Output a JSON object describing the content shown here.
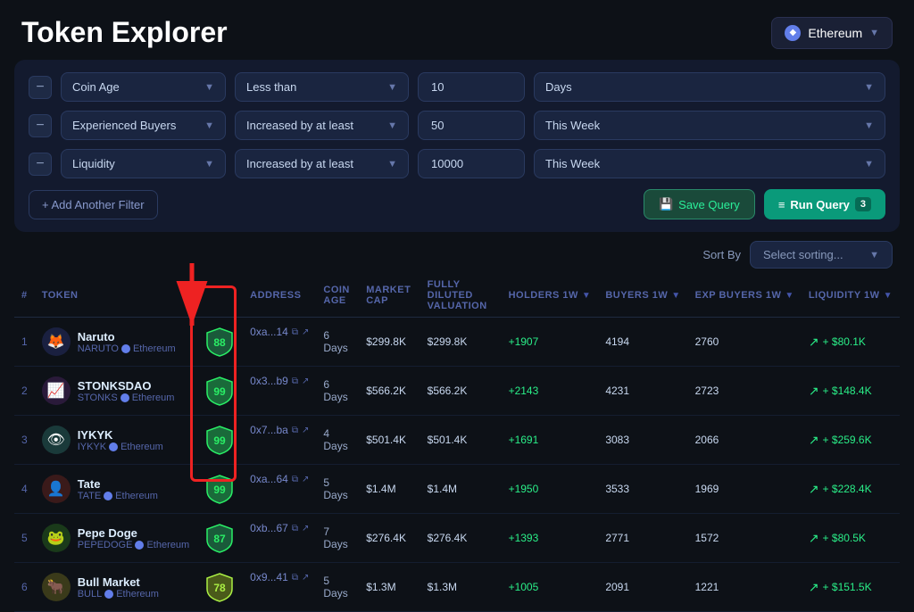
{
  "page": {
    "title": "Token Explorer"
  },
  "network": {
    "label": "Ethereum",
    "icon": "ethereum-icon"
  },
  "filters": [
    {
      "id": 1,
      "category": "Coin Age",
      "condition": "Less than",
      "value": "10",
      "period": "Days"
    },
    {
      "id": 2,
      "category": "Experienced Buyers",
      "condition": "Increased by at least",
      "value": "50",
      "period": "This Week"
    },
    {
      "id": 3,
      "category": "Liquidity",
      "condition": "Increased by at least",
      "value": "10000",
      "period": "This Week"
    }
  ],
  "actions": {
    "add_filter": "+ Add Another Filter",
    "save_query": "Save Query",
    "run_query": "Run Query",
    "run_badge": "3"
  },
  "sort": {
    "label": "Sort By",
    "placeholder": "Select sorting..."
  },
  "table": {
    "headers": [
      "#",
      "TOKEN",
      "",
      "ADDRESS",
      "COIN AGE",
      "MARKET CAP",
      "FULLY DILUTED VALUATION",
      "HOLDERS 1W",
      "BUYERS 1W",
      "EXP BUYERS 1W",
      "LIQUIDITY 1W"
    ],
    "rows": [
      {
        "rank": 1,
        "name": "Naruto",
        "ticker": "NARUTO",
        "chain": "Ethereum",
        "score": 88,
        "score_type": "high",
        "address": "0xa...14",
        "coin_age": "6 Days",
        "market_cap": "$299.8K",
        "fdv": "$299.8K",
        "holders": "+1907",
        "buyers": "4194",
        "exp_buyers": "2760",
        "liquidity": "+ $80.1K",
        "avatar": "🦊"
      },
      {
        "rank": 2,
        "name": "STONKSDAO",
        "ticker": "STONKS",
        "chain": "Ethereum",
        "score": 99,
        "score_type": "high",
        "address": "0x3...b9",
        "coin_age": "6 Days",
        "market_cap": "$566.2K",
        "fdv": "$566.2K",
        "holders": "+2143",
        "buyers": "4231",
        "exp_buyers": "2723",
        "liquidity": "+ $148.4K",
        "avatar": "📈"
      },
      {
        "rank": 3,
        "name": "IYKYK",
        "ticker": "IYKYK",
        "chain": "Ethereum",
        "score": 99,
        "score_type": "high",
        "address": "0x7...ba",
        "coin_age": "4 Days",
        "market_cap": "$501.4K",
        "fdv": "$501.4K",
        "holders": "+1691",
        "buyers": "3083",
        "exp_buyers": "2066",
        "liquidity": "+ $259.6K",
        "avatar": "👁"
      },
      {
        "rank": 4,
        "name": "Tate",
        "ticker": "TATE",
        "chain": "Ethereum",
        "score": 99,
        "score_type": "high",
        "address": "0xa...64",
        "coin_age": "5 Days",
        "market_cap": "$1.4M",
        "fdv": "$1.4M",
        "holders": "+1950",
        "buyers": "3533",
        "exp_buyers": "1969",
        "liquidity": "+ $228.4K",
        "avatar": "👤"
      },
      {
        "rank": 5,
        "name": "Pepe Doge",
        "ticker": "PEPEDOGE",
        "chain": "Ethereum",
        "score": 87,
        "score_type": "high",
        "address": "0xb...67",
        "coin_age": "7 Days",
        "market_cap": "$276.4K",
        "fdv": "$276.4K",
        "holders": "+1393",
        "buyers": "2771",
        "exp_buyers": "1572",
        "liquidity": "+ $80.5K",
        "avatar": "🐸"
      },
      {
        "rank": 6,
        "name": "Bull Market",
        "ticker": "BULL",
        "chain": "Ethereum",
        "score": 78,
        "score_type": "med",
        "address": "0x9...41",
        "coin_age": "5 Days",
        "market_cap": "$1.3M",
        "fdv": "$1.3M",
        "holders": "+1005",
        "buyers": "2091",
        "exp_buyers": "1221",
        "liquidity": "+ $151.5K",
        "avatar": "🐂"
      }
    ]
  }
}
